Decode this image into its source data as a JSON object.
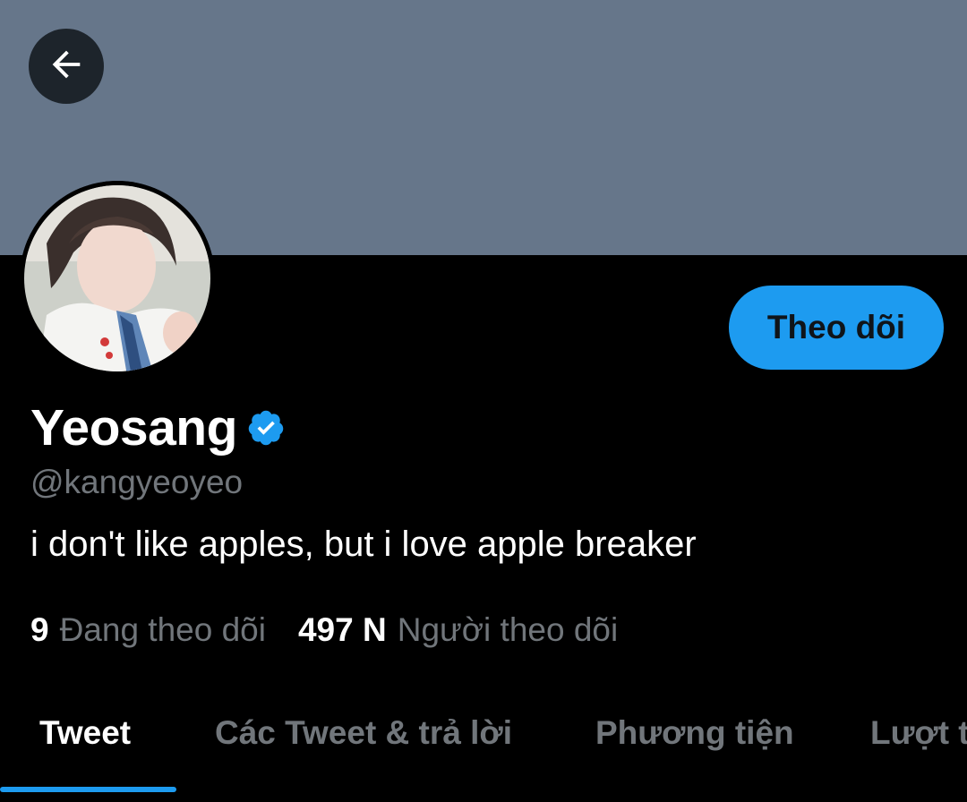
{
  "header": {
    "banner_color": "#66768a",
    "back_icon": "arrow-left-icon"
  },
  "profile": {
    "display_name": "Yeosang",
    "verified": true,
    "handle": "@kangyeoyeo",
    "bio": "i don't like apples, but i love apple breaker",
    "follow_button_label": "Theo dõi",
    "following_count": "9",
    "following_label": "Đang theo dõi",
    "followers_count": "497 N",
    "followers_label": "Người theo dõi"
  },
  "tabs": [
    {
      "label": "Tweet",
      "active": true
    },
    {
      "label": "Các Tweet & trả lời",
      "active": false
    },
    {
      "label": "Phương tiện",
      "active": false
    },
    {
      "label": "Lượt t",
      "active": false
    }
  ],
  "colors": {
    "accent": "#1d9bf0",
    "background": "#000000",
    "muted_text": "#71767b"
  }
}
